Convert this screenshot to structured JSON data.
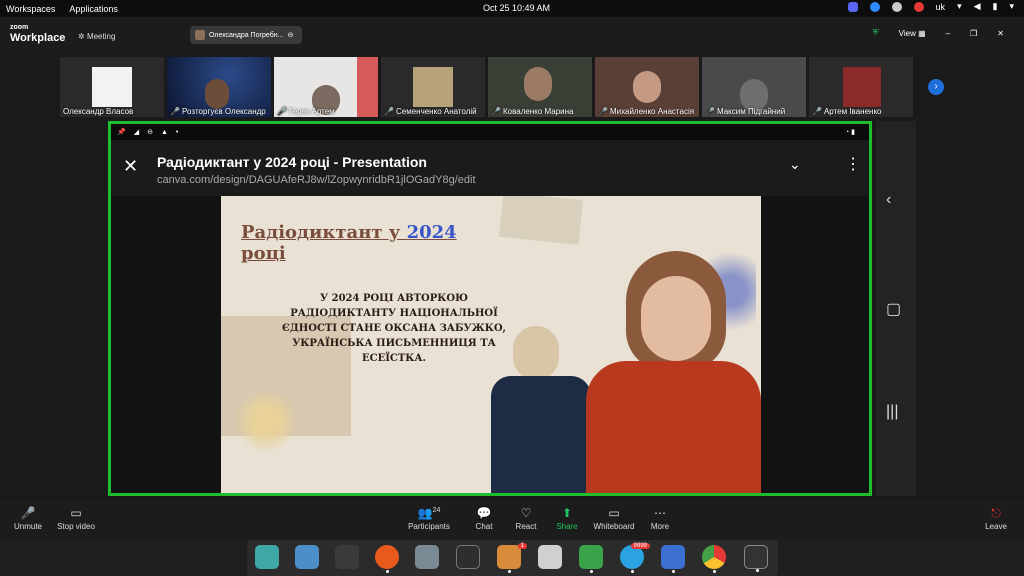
{
  "system_bar": {
    "workspaces": "Workspaces",
    "applications": "Applications",
    "datetime": "Oct 25  10:49 AM",
    "language": "uk"
  },
  "zoom": {
    "logo_top": "zoom",
    "logo_bottom": "Workplace",
    "meeting_label": "Meeting",
    "speaker": "Олександра Погребн...",
    "view_label": "View"
  },
  "participants": [
    {
      "name": "Олександр Власов",
      "muted": false
    },
    {
      "name": "Розторгуєв Олександр",
      "muted": true
    },
    {
      "name": "Геряк Артем",
      "muted": true
    },
    {
      "name": "Семенченко Анатолій",
      "muted": true
    },
    {
      "name": "Коваленко Марина",
      "muted": true
    },
    {
      "name": "Михайленко Анастасія",
      "muted": true
    },
    {
      "name": "Максим Підгайний",
      "muted": true
    },
    {
      "name": "Артем Іваненко",
      "muted": true
    }
  ],
  "shared": {
    "page_title": "Радіодиктант у 2024 році - Presentation",
    "url": "canva.com/design/DAGUAfeRJ8w/lZopwynridbR1jlOGadY8g/edit",
    "slide_title_part1": "Радіодиктант у ",
    "slide_title_year": "2024",
    "slide_title_part2": "році",
    "slide_body": "У 2024 РОЦІ АВТОРКОЮ РАДІОДИКТАНТУ НАЦІОНАЛЬНОЇ ЄДНОСТІ СТАНЕ ОКСАНА ЗАБУЖКО, УКРАЇНСЬКА ПИСЬМЕННИЦЯ ТА ЕСЕЇСТКА."
  },
  "toolbar": {
    "unmute": "Unmute",
    "stop_video": "Stop video",
    "participants": "Participants",
    "participants_count": "24",
    "chat": "Chat",
    "react": "React",
    "share": "Share",
    "whiteboard": "Whiteboard",
    "more": "More",
    "leave": "Leave"
  },
  "dock": {
    "files_badge": "1",
    "telegram_badge": "9999"
  },
  "colors": {
    "share_border": "#1fbd2c",
    "share_green": "#22c55e",
    "accent_blue": "#1e6fd9"
  }
}
